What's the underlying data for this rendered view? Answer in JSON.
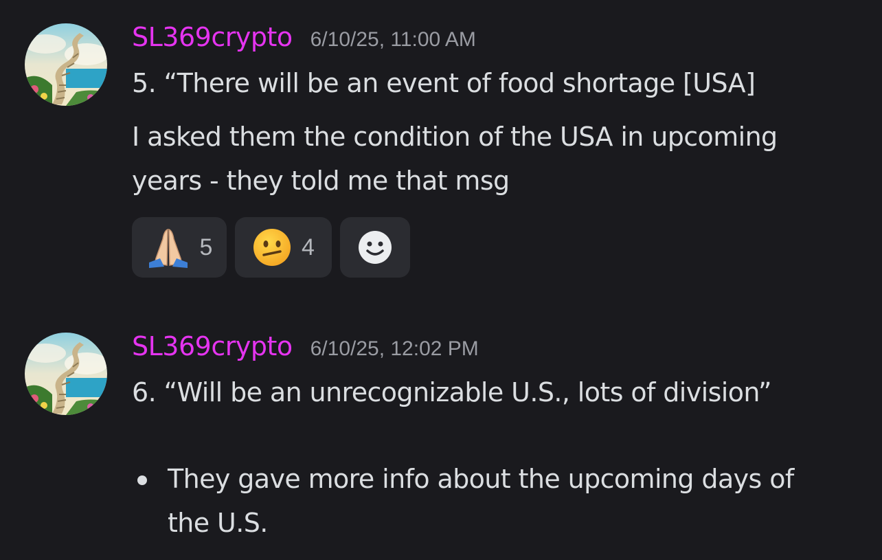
{
  "messages": [
    {
      "username": "SL369crypto",
      "timestamp": "6/10/25, 11:00 AM",
      "lines": [
        "5.  “There will be an event of food shortage [USA]",
        "I asked them the condition of the USA in upcoming",
        "years - they told me that msg"
      ],
      "reactions": [
        {
          "icon": "folded-hands-emoji",
          "count": "5"
        },
        {
          "icon": "neutral-face-emoji",
          "count": "4"
        },
        {
          "icon": "add-reaction-icon"
        }
      ]
    },
    {
      "username": "SL369crypto",
      "timestamp": "6/10/25, 12:02 PM",
      "lines": [
        "6.  “Will be an unrecognizable U.S., lots of division”"
      ],
      "bullet": [
        "They gave more info about the upcoming days of",
        "the U.S."
      ]
    }
  ],
  "colors": {
    "background": "#1a1a1e",
    "username": "#e534f0",
    "timestamp": "#9a9ca3",
    "text": "#dbdee1",
    "reaction_bg": "#2b2c31"
  }
}
